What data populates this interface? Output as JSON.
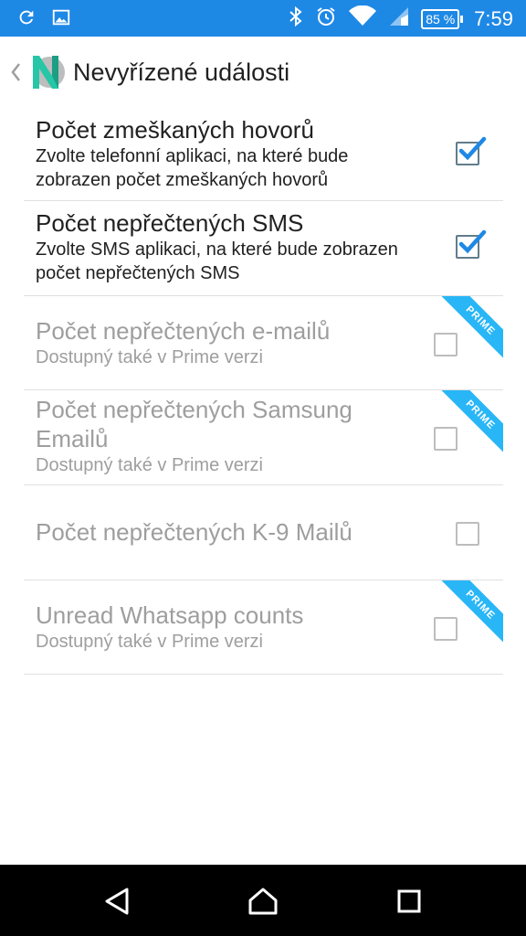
{
  "status_bar": {
    "battery": "85 %",
    "clock": "7:59",
    "icons": [
      "sync-icon",
      "image-icon",
      "bluetooth-icon",
      "alarm-icon",
      "wifi-icon",
      "signal-icon",
      "battery-icon"
    ]
  },
  "app_bar": {
    "title": "Nevyřízené události",
    "logo": "N"
  },
  "items": [
    {
      "title": "Počet zmeškaných hovorů",
      "summary": "Zvolte telefonní aplikaci, na které bude zobrazen počet zmeškaných hovorů",
      "checked": true,
      "enabled": true,
      "prime": false
    },
    {
      "title": "Počet nepřečtených SMS",
      "summary": "Zvolte SMS aplikaci, na které bude zobrazen počet nepřečtených SMS",
      "checked": true,
      "enabled": true,
      "prime": false
    },
    {
      "title": "Počet nepřečtených e-mailů",
      "summary": "Dostupný také v Prime verzi",
      "checked": false,
      "enabled": false,
      "prime": true
    },
    {
      "title": "Počet nepřečtených Samsung Emailů",
      "summary": "Dostupný také v Prime verzi",
      "checked": false,
      "enabled": false,
      "prime": true
    },
    {
      "title": "Počet nepřečtených K-9 Mailů",
      "summary": "",
      "checked": false,
      "enabled": false,
      "prime": false
    },
    {
      "title": "Unread Whatsapp counts",
      "summary": "Dostupný také v Prime verzi",
      "checked": false,
      "enabled": false,
      "prime": true
    }
  ],
  "prime_label": "PRIME",
  "colors": {
    "status_bar": "#1e88e5",
    "accent_check": "#1e88e5",
    "prime_ribbon": "#29b6f6",
    "disabled_text": "#9e9e9e"
  }
}
